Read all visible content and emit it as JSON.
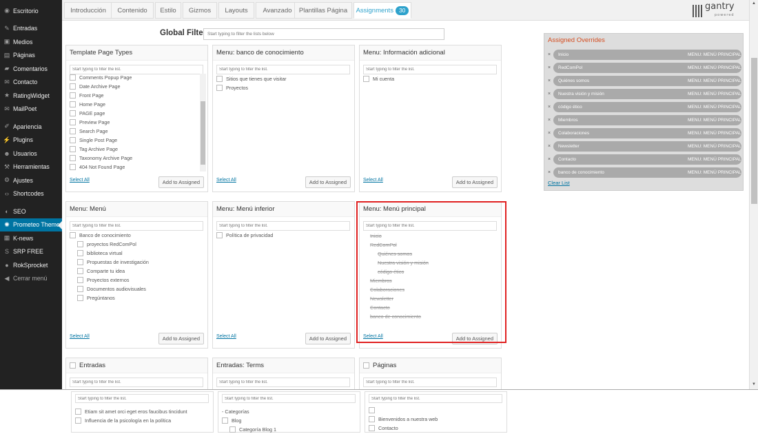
{
  "sidebar": {
    "items": [
      {
        "label": "Escritorio",
        "icon": "dashboard-icon",
        "glyph": "◉"
      },
      {
        "label": "Entradas",
        "icon": "pin-icon",
        "glyph": "✎"
      },
      {
        "label": "Medios",
        "icon": "media-icon",
        "glyph": "▣"
      },
      {
        "label": "Páginas",
        "icon": "pages-icon",
        "glyph": "▤"
      },
      {
        "label": "Comentarios",
        "icon": "comments-icon",
        "glyph": "▰"
      },
      {
        "label": "Contacto",
        "icon": "mail-icon",
        "glyph": "✉"
      },
      {
        "label": "RatingWidget",
        "icon": "rating-icon",
        "glyph": "★"
      },
      {
        "label": "MailPoet",
        "icon": "mailpoet-icon",
        "glyph": "✉"
      },
      {
        "label": "Apariencia",
        "icon": "appearance-icon",
        "glyph": "✐"
      },
      {
        "label": "Plugins",
        "icon": "plugins-icon",
        "glyph": "⚡"
      },
      {
        "label": "Usuarios",
        "icon": "users-icon",
        "glyph": "☻"
      },
      {
        "label": "Herramientas",
        "icon": "tools-icon",
        "glyph": "⚒"
      },
      {
        "label": "Ajustes",
        "icon": "settings-icon",
        "glyph": "⚙"
      },
      {
        "label": "Shortcodes",
        "icon": "shortcodes-icon",
        "glyph": "‹›"
      },
      {
        "label": "SEO",
        "icon": "seo-icon",
        "glyph": "◐"
      },
      {
        "label": "Prometeo Theme",
        "icon": "theme-icon",
        "glyph": "✺"
      },
      {
        "label": "K-news",
        "icon": "knews-icon",
        "glyph": "▦"
      },
      {
        "label": "SRP FREE",
        "icon": "srp-icon",
        "glyph": "S"
      },
      {
        "label": "RokSprocket",
        "icon": "roksprocket-icon",
        "glyph": "●"
      },
      {
        "label": "Cerrar menú",
        "icon": "collapse-icon",
        "glyph": "◀"
      }
    ]
  },
  "tabs": [
    {
      "label": "Introducción"
    },
    {
      "label": "Contenido"
    },
    {
      "label": "Estilo"
    },
    {
      "label": "Gizmos"
    },
    {
      "label": "Layouts"
    },
    {
      "label": "Avanzado"
    },
    {
      "label": "Plantillas Página"
    },
    {
      "label": "Assignments",
      "badge": "30"
    }
  ],
  "logo": {
    "text": "gantry",
    "sub": "powered"
  },
  "global_filter": {
    "label": "Global Filter",
    "placeholder": "Start typing to filter the lists below"
  },
  "filter_placeholder": "Start typing to filter the list.",
  "select_all": "Select All",
  "add_button": "Add to Assigned",
  "panels": {
    "template_types": {
      "title": "Template Page Types",
      "items": [
        "Comments Popup Page",
        "Date Archive Page",
        "Front Page",
        "Home Page",
        "PAGE page",
        "Preview Page",
        "Search Page",
        "Single Post Page",
        "Tag Archive Page",
        "Taxonomy Archive Page",
        "404 Not Found Page"
      ]
    },
    "banco": {
      "title": "Menu: banco de conocimiento",
      "items": [
        "Sitios que tienes que visitar",
        "Proyectos"
      ]
    },
    "info": {
      "title": "Menu: Información adicional",
      "items": [
        "Mi cuenta"
      ]
    },
    "menu": {
      "title": "Menu: Menú",
      "items": [
        {
          "label": "Banco de conocimiento",
          "level": 0
        },
        {
          "label": "proyectos RedComPol",
          "level": 1
        },
        {
          "label": "biblioteca virtual",
          "level": 1
        },
        {
          "label": "Propuestas de investigación",
          "level": 1
        },
        {
          "label": "Comparte tu idea",
          "level": 1
        },
        {
          "label": "Proyectos externos",
          "level": 1
        },
        {
          "label": "Documentos audiovisuales",
          "level": 1
        },
        {
          "label": "Pregúntanos",
          "level": 1
        }
      ]
    },
    "inferior": {
      "title": "Menu: Menú inferior",
      "items": [
        "Política de privacidad"
      ]
    },
    "principal": {
      "title": "Menu: Menú principal",
      "items": [
        {
          "label": "Inicio",
          "level": 0
        },
        {
          "label": "RedComPol",
          "level": 0
        },
        {
          "label": "Quiénes somos",
          "level": 1
        },
        {
          "label": "Nuestra visión y misión",
          "level": 1
        },
        {
          "label": "código ético",
          "level": 1
        },
        {
          "label": "Miembros",
          "level": 0
        },
        {
          "label": "Colaboraciones",
          "level": 0
        },
        {
          "label": "Newsletter",
          "level": 0
        },
        {
          "label": "Contacto",
          "level": 0
        },
        {
          "label": "banco de conocimiento",
          "level": 0
        }
      ]
    },
    "entradas": {
      "title": "Entradas"
    },
    "terms": {
      "title": "Entradas: Terms"
    },
    "paginas": {
      "title": "Páginas"
    }
  },
  "overrides": {
    "title": "Assigned Overrides",
    "menu_label": "MENU: MENÚ PRINCIPAL",
    "items": [
      "Inicio",
      "RedComPol",
      "Quiénes somos",
      "Nuestra visión y misión",
      "código ético",
      "Miembros",
      "Colaboraciones",
      "Newsletter",
      "Contacto",
      "banco de conocimiento"
    ],
    "clear": "Clear List"
  },
  "bottom": {
    "posts": [
      "Etiam sit amet orci eget eros faucibus tincidunt",
      "Influencia de la psicología en la política"
    ],
    "terms_header": "- Categorías",
    "terms": [
      "Blog",
      "Categoría Blog 1"
    ],
    "pages": [
      "",
      "Bienvenidos a nuestra web",
      "Contacto"
    ]
  }
}
